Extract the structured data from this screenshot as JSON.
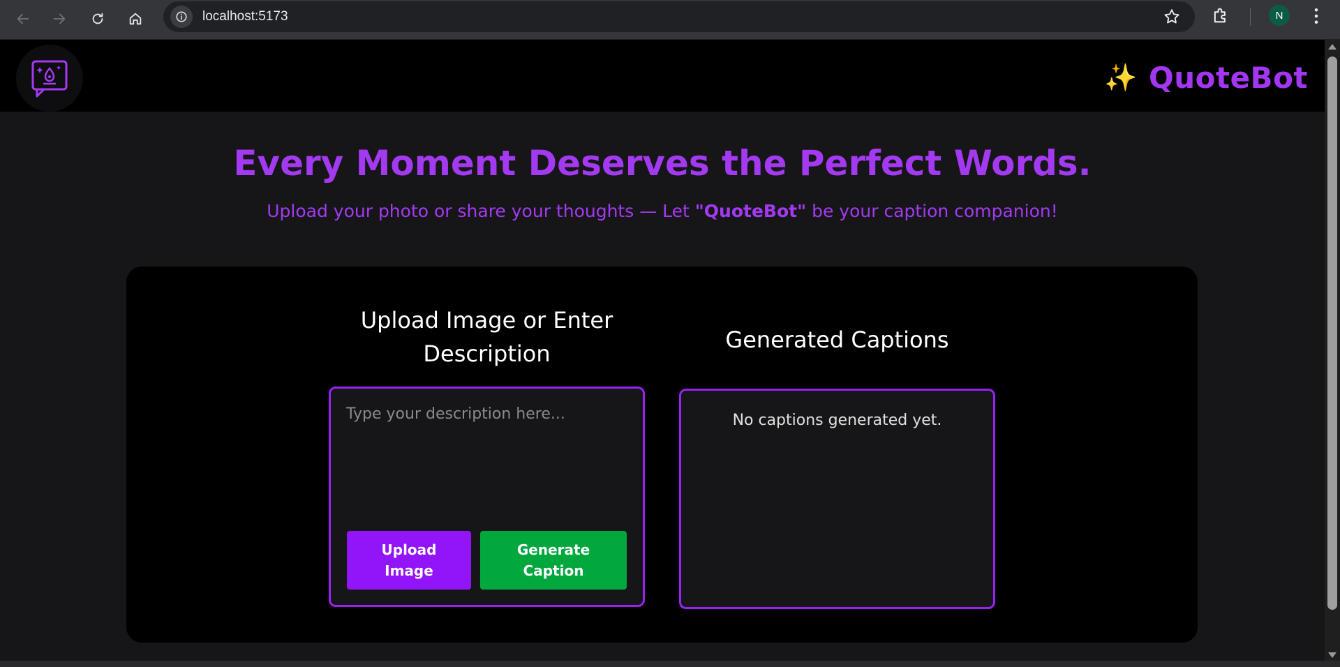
{
  "browser": {
    "url": "localhost:5173",
    "profile_initial": "N",
    "icons": [
      "back-icon",
      "forward-icon",
      "reload-icon",
      "home-icon",
      "site-info-icon",
      "bookmark-star-icon",
      "extensions-icon",
      "more-menu-icon"
    ]
  },
  "header": {
    "logo_icon": "chat-sparkle-logo-icon",
    "brand_emoji": "✨",
    "brand_name": "QuoteBot"
  },
  "hero": {
    "title": "Every Moment Deserves the Perfect Words.",
    "subtitle_prefix": "Upload your photo or share your thoughts — Let ",
    "subtitle_bold": "\"QuoteBot\"",
    "subtitle_suffix": " be your caption companion!"
  },
  "input_panel": {
    "title_line1": "Upload Image or Enter",
    "title_line2": "Description",
    "placeholder": "Type your description here...",
    "value": "",
    "upload_label_line1": "Upload",
    "upload_label_line2": "Image",
    "generate_label_line1": "Generate",
    "generate_label_line2": "Caption"
  },
  "output_panel": {
    "title": "Generated Captions",
    "empty_message": "No captions generated yet."
  },
  "colors": {
    "accent_purple": "#a33af2",
    "border_purple": "#9a20f6",
    "upload_button": "#9214f8",
    "generate_button": "#02a73e",
    "page_bg": "#161618",
    "panel_bg": "#000000"
  }
}
